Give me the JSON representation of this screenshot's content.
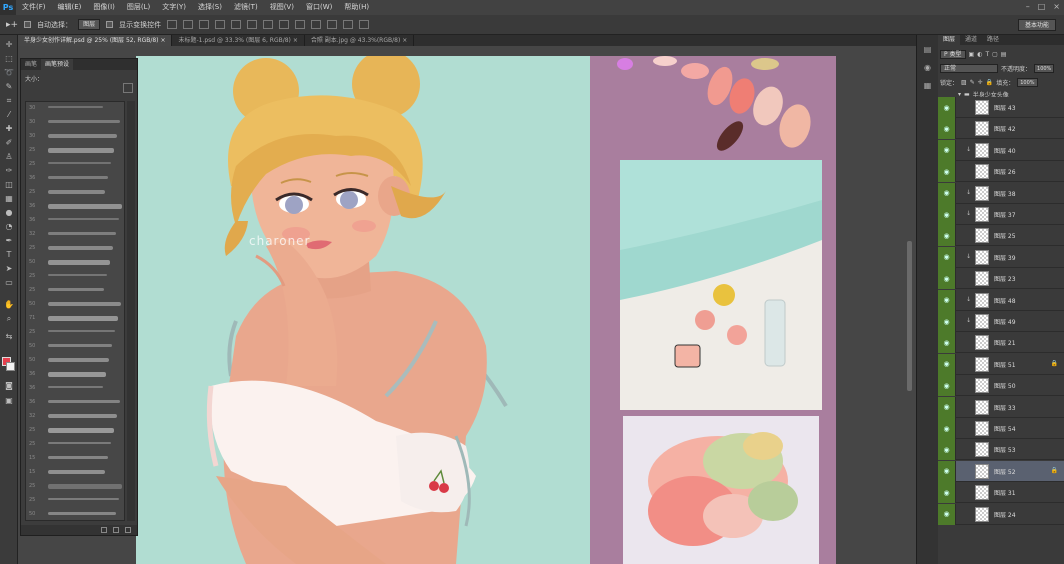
{
  "app": {
    "logo": "Ps",
    "menu": [
      "文件(F)",
      "编辑(E)",
      "图像(I)",
      "图层(L)",
      "文字(Y)",
      "选择(S)",
      "滤镜(T)",
      "视图(V)",
      "窗口(W)",
      "帮助(H)"
    ]
  },
  "options": {
    "auto_select_label": "自动选择：",
    "auto_select_value": "图层",
    "show_transform_label": "显示变换控件",
    "workspace": "基本功能"
  },
  "doc_tabs": [
    {
      "label": "半身少女创作详解.psd @ 25% (图层 52, RGB/8)",
      "close": "×"
    },
    {
      "label": "未标题-1.psd @ 33.3% (图层 6, RGB/8)",
      "close": "×"
    },
    {
      "label": "合照 副本.jpg @ 43.3%(RGB/8)",
      "close": "×"
    }
  ],
  "brush_panel": {
    "tabs": [
      "画笔",
      "画笔预设"
    ],
    "size_label": "大小：",
    "brush_numbers": [
      "30",
      "30",
      "30",
      "25",
      "25",
      "36",
      "25",
      "36",
      "36",
      "32",
      "25",
      "50",
      "25",
      "25",
      "50",
      "71",
      "25",
      "50",
      "50",
      "36",
      "36",
      "36",
      "32",
      "25",
      "25",
      "15",
      "15",
      "25",
      "25",
      "50"
    ]
  },
  "canvas": {
    "watermark": "charoner"
  },
  "layers_panel": {
    "tabs": [
      "图层",
      "通道",
      "路径"
    ],
    "filter_label": "P 类型",
    "blend_mode": "正常",
    "opacity_label": "不透明度：",
    "opacity_value": "100%",
    "lock_label": "锁定：",
    "fill_label": "填充：",
    "fill_value": "100%",
    "group_name": "半身少女头像",
    "layers": [
      {
        "name": "图层 43",
        "clip": "",
        "lock": ""
      },
      {
        "name": "图层 42",
        "clip": "",
        "lock": ""
      },
      {
        "name": "图层 40",
        "clip": "↓",
        "lock": ""
      },
      {
        "name": "图层 26",
        "clip": "",
        "lock": ""
      },
      {
        "name": "图层 38",
        "clip": "↓",
        "lock": ""
      },
      {
        "name": "图层 37",
        "clip": "↓",
        "lock": ""
      },
      {
        "name": "图层 25",
        "clip": "",
        "lock": ""
      },
      {
        "name": "图层 39",
        "clip": "↓",
        "lock": ""
      },
      {
        "name": "图层 23",
        "clip": "",
        "lock": ""
      },
      {
        "name": "图层 48",
        "clip": "↓",
        "lock": ""
      },
      {
        "name": "图层 49",
        "clip": "↓",
        "lock": ""
      },
      {
        "name": "图层 21",
        "clip": "",
        "lock": ""
      },
      {
        "name": "图层 51",
        "clip": "",
        "lock": "🔒"
      },
      {
        "name": "图层 50",
        "clip": "",
        "lock": ""
      },
      {
        "name": "图层 33",
        "clip": "",
        "lock": ""
      },
      {
        "name": "图层 54",
        "clip": "",
        "lock": ""
      },
      {
        "name": "图层 53",
        "clip": "",
        "lock": ""
      },
      {
        "name": "图层 52",
        "clip": "",
        "lock": "🔒",
        "selected": true
      },
      {
        "name": "图层 31",
        "clip": "",
        "lock": ""
      },
      {
        "name": "图层 24",
        "clip": "",
        "lock": ""
      }
    ]
  }
}
